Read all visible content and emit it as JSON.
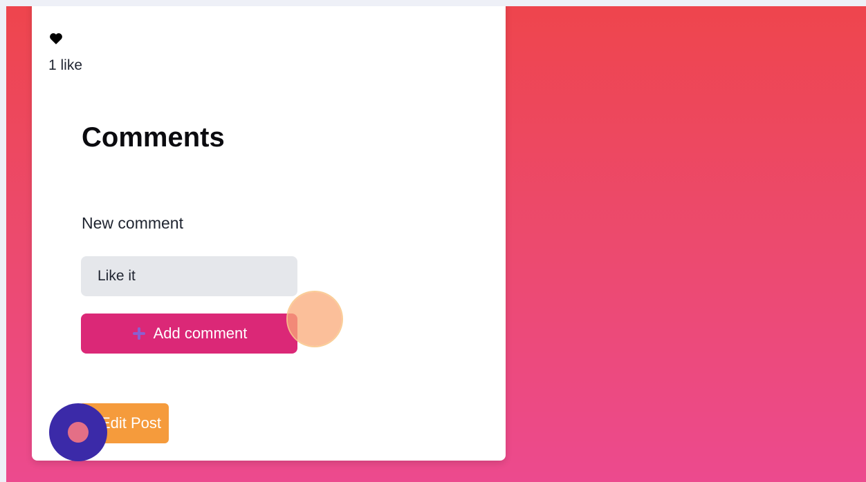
{
  "post": {
    "likes_text": "1 like"
  },
  "comments": {
    "title": "Comments",
    "new_comment_label": "New comment",
    "input_value": "Like it",
    "add_button_label": "Add comment"
  },
  "actions": {
    "edit_post_label": "Edit Post"
  },
  "icons": {
    "like": "heart-icon",
    "add": "plus-icon"
  },
  "colors": {
    "background_top": "#ee454d",
    "background_bottom": "#ec4a8e",
    "add_button": "#db2877",
    "edit_button": "#f59b3c",
    "input_background": "#e5e7eb"
  }
}
